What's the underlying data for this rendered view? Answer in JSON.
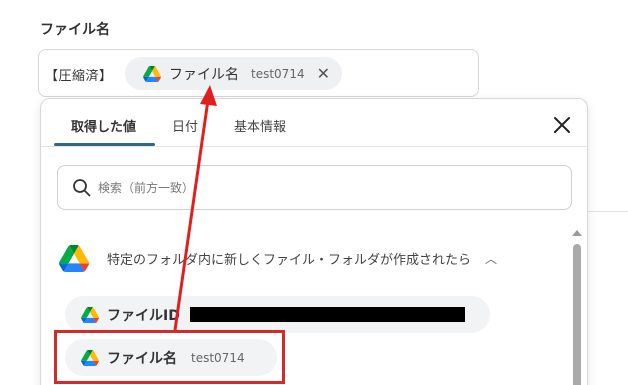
{
  "field": {
    "label": "ファイル名",
    "prefix": "【圧縮済】",
    "token": {
      "name": "ファイル名",
      "value": "test0714",
      "remove_icon": "close-icon",
      "icon": "google-drive-icon"
    }
  },
  "popup": {
    "tabs": [
      {
        "label": "取得した値",
        "active": true
      },
      {
        "label": "日付",
        "active": false
      },
      {
        "label": "基本情報",
        "active": false
      }
    ],
    "close_icon": "close-icon",
    "search": {
      "placeholder": "検索（前方一致）",
      "value": "",
      "icon": "search-icon"
    },
    "section": {
      "title": "特定のフォルダ内に新しくファイル・フォルダが作成されたら",
      "icon": "google-drive-icon",
      "expanded": true
    },
    "items": [
      {
        "name": "ファイルID",
        "value": "",
        "redacted": true,
        "icon": "google-drive-icon"
      },
      {
        "name": "ファイル名",
        "value": "test0714",
        "redacted": false,
        "icon": "google-drive-icon"
      }
    ]
  },
  "annotation": {
    "highlight_color": "#d42a2a",
    "arrow_color": "#e02020"
  },
  "colors": {
    "tab_accent": "#2c6a85",
    "drive_green": "#0f9d58",
    "drive_yellow": "#f4b400",
    "drive_blue": "#4285f4"
  }
}
